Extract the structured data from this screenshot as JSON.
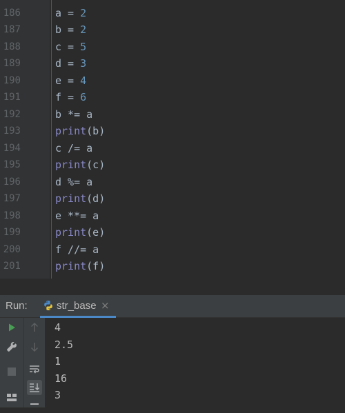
{
  "editor": {
    "lines": [
      {
        "num": "186",
        "var": "a",
        "op": " = ",
        "val": "2",
        "type": "assign"
      },
      {
        "num": "187",
        "var": "b",
        "op": " = ",
        "val": "2",
        "type": "assign"
      },
      {
        "num": "188",
        "var": "c",
        "op": " = ",
        "val": "5",
        "type": "assign"
      },
      {
        "num": "189",
        "var": "d",
        "op": " = ",
        "val": "3",
        "type": "assign"
      },
      {
        "num": "190",
        "var": "e",
        "op": " = ",
        "val": "4",
        "type": "assign"
      },
      {
        "num": "191",
        "var": "f",
        "op": " = ",
        "val": "6",
        "type": "assign"
      },
      {
        "num": "192",
        "text": "b *= a",
        "type": "plain"
      },
      {
        "num": "193",
        "fn": "print",
        "arg": "(b)",
        "type": "print"
      },
      {
        "num": "194",
        "text": "c /= a",
        "type": "plain"
      },
      {
        "num": "195",
        "fn": "print",
        "arg": "(c)",
        "type": "print"
      },
      {
        "num": "196",
        "text": "d %= a",
        "type": "plain"
      },
      {
        "num": "197",
        "fn": "print",
        "arg": "(d)",
        "type": "print"
      },
      {
        "num": "198",
        "text": "e **= a",
        "type": "plain"
      },
      {
        "num": "199",
        "fn": "print",
        "arg": "(e)",
        "type": "print"
      },
      {
        "num": "200",
        "text": "f //= a",
        "type": "plain"
      },
      {
        "num": "201",
        "fn": "print",
        "arg": "(f)",
        "type": "print"
      }
    ]
  },
  "run_panel": {
    "label": "Run:",
    "tab_name": "str_base",
    "tab_close": "×"
  },
  "console": {
    "output": [
      "4",
      "2.5",
      "1",
      "16",
      "3"
    ]
  },
  "colors": {
    "accent": "#4a88c7",
    "run_green": "#499c54",
    "number": "#6897bb",
    "builtin": "#8888c6"
  }
}
